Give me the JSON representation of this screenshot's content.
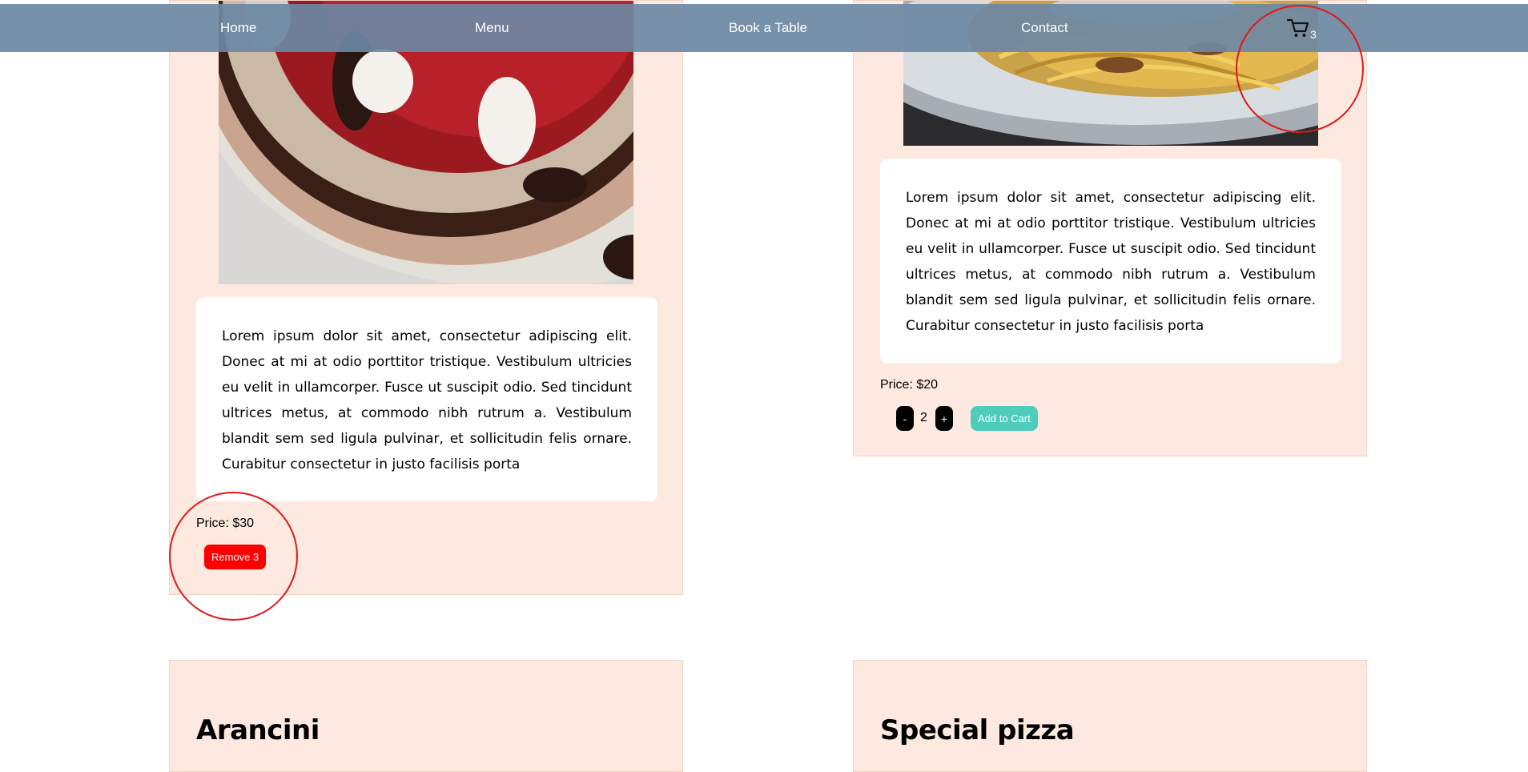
{
  "nav": {
    "home": "Home",
    "menu": "Menu",
    "book": "Book a Table",
    "contact": "Contact",
    "cart_count": "3"
  },
  "items": [
    {
      "description": "Lorem ipsum dolor sit amet, consectetur adipiscing elit. Donec at mi at odio porttitor tristique. Vestibulum ultricies eu velit in ullamcorper. Fusce ut suscipit odio. Sed tincidunt ultrices metus, at commodo nibh rutrum a. Vestibulum blandit sem sed ligula pulvinar, et sollicitudin felis ornare. Curabitur consectetur in justo facilisis porta",
      "price": "Price: $30",
      "remove_label": "Remove 3"
    },
    {
      "description": "Lorem ipsum dolor sit amet, consectetur adipiscing elit. Donec at mi at odio porttitor tristique. Vestibulum ultricies eu velit in ullamcorper. Fusce ut suscipit odio. Sed tincidunt ultrices metus, at commodo nibh rutrum a. Vestibulum blandit sem sed ligula pulvinar, et sollicitudin felis ornare. Curabitur consectetur in justo facilisis porta",
      "price": "Price: $20",
      "minus_label": "-",
      "quantity": "2",
      "plus_label": "+",
      "add_label": "Add to Cart"
    },
    {
      "title": "Arancini"
    },
    {
      "title": "Special pizza"
    }
  ],
  "colors": {
    "nav_bg": "#6c88a3",
    "card_bg": "#fde9df",
    "remove_btn": "#ff0000",
    "add_btn": "#4ecdbc",
    "highlight_ring": "#e01818"
  },
  "icons": {
    "cart": "shopping-cart-icon"
  }
}
